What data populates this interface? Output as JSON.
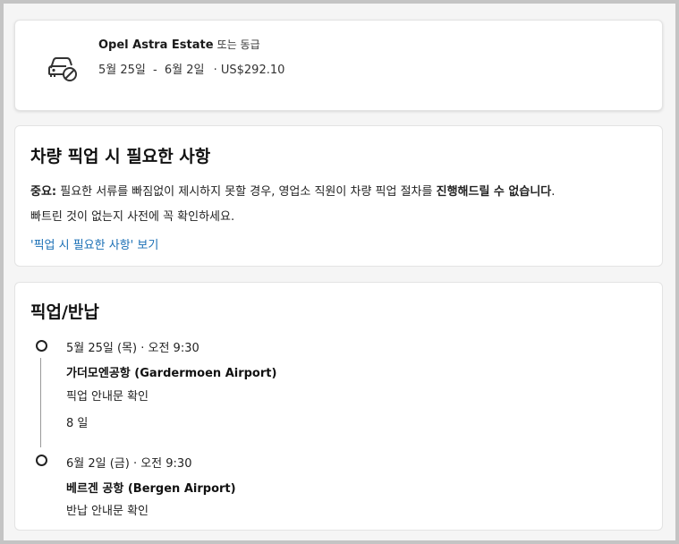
{
  "car": {
    "name": "Opel Astra Estate",
    "grade": "또는 동급",
    "date_start": "5월 25일",
    "date_sep": "-",
    "date_end": "6월 2일",
    "price": "· US$292.10",
    "icon": "car-unavailable-icon"
  },
  "requirements": {
    "title": "차량 픽업 시 필요한 사항",
    "notice_prefix": "중요:",
    "notice_text": " 필요한 서류를 빠짐없이 제시하지 못할 경우, 영업소 직원이 차량 픽업 절차를 ",
    "notice_bold": "진행해드릴 수 없습니다",
    "notice_end": ".",
    "notice_line2": "빠트린 것이 없는지 사전에 꼭 확인하세요.",
    "link": "'픽업 시 필요한 사항' 보기"
  },
  "pickup_return": {
    "title": "픽업/반납",
    "pickup": {
      "datetime": "5월 25일 (목) · 오전 9:30",
      "location": "가더모엔공항 (Gardermoen Airport)",
      "link": "픽업 안내문 확인"
    },
    "duration": "8 일",
    "return": {
      "datetime": "6월 2일 (금) · 오전 9:30",
      "location": "베르겐 공항 (Bergen Airport)",
      "link": "반납 안내문 확인"
    }
  },
  "colors": {
    "link": "#1a6fb5",
    "background": "#f5f5f5",
    "card": "#ffffff"
  }
}
